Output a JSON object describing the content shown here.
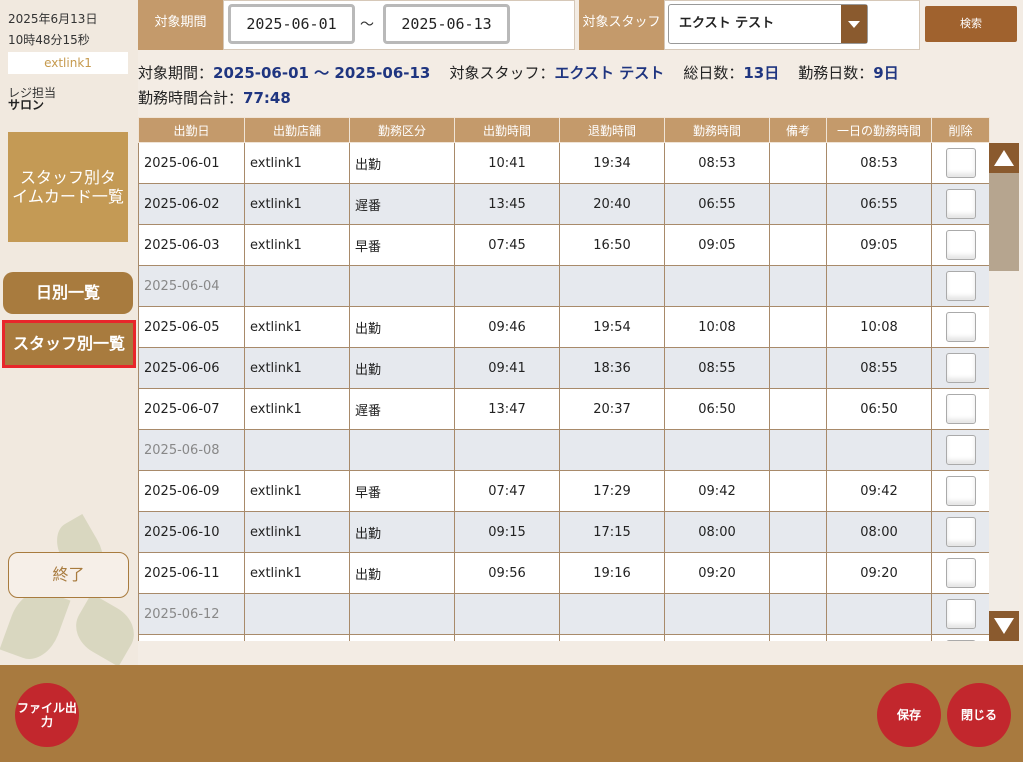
{
  "sidebar": {
    "date": "2025年6月13日",
    "time": "10時48分15秒",
    "store": "extlink1",
    "role": "レジ担当",
    "salon": "サロン",
    "timecard_button": "スタッフ別タイムカード一覧",
    "daily_button": "日別一覧",
    "staff_button": "スタッフ別一覧",
    "end_button": "終了"
  },
  "filter": {
    "period_label": "対象期間",
    "date_from": "2025-06-01",
    "tilde": "～",
    "date_to": "2025-06-13",
    "staff_label": "対象スタッフ",
    "staff_value": "エクスト テスト",
    "search_button": "検索"
  },
  "summary": {
    "period_key": "対象期間：",
    "period_value": "2025-06-01 ～ 2025-06-13",
    "staff_key": "対象スタッフ：",
    "staff_value": "エクスト テスト",
    "total_days_key": "総日数：",
    "total_days_value": "13日",
    "work_days_key": "勤務日数：",
    "work_days_value": "9日",
    "total_hours_key": "勤務時間合計：",
    "total_hours_value": "77:48"
  },
  "table": {
    "headers": [
      "出勤日",
      "出勤店舗",
      "勤務区分",
      "出勤時間",
      "退勤時間",
      "勤務時間",
      "備考",
      "一日の勤務時間",
      "削除"
    ],
    "rows": [
      [
        "2025-06-01",
        "extlink1",
        "出勤",
        "10:41",
        "19:34",
        "08:53",
        "",
        "08:53"
      ],
      [
        "2025-06-02",
        "extlink1",
        "遅番",
        "13:45",
        "20:40",
        "06:55",
        "",
        "06:55"
      ],
      [
        "2025-06-03",
        "extlink1",
        "早番",
        "07:45",
        "16:50",
        "09:05",
        "",
        "09:05"
      ],
      [
        "2025-06-04",
        "",
        "",
        "",
        "",
        "",
        "",
        ""
      ],
      [
        "2025-06-05",
        "extlink1",
        "出勤",
        "09:46",
        "19:54",
        "10:08",
        "",
        "10:08"
      ],
      [
        "2025-06-06",
        "extlink1",
        "出勤",
        "09:41",
        "18:36",
        "08:55",
        "",
        "08:55"
      ],
      [
        "2025-06-07",
        "extlink1",
        "遅番",
        "13:47",
        "20:37",
        "06:50",
        "",
        "06:50"
      ],
      [
        "2025-06-08",
        "",
        "",
        "",
        "",
        "",
        "",
        ""
      ],
      [
        "2025-06-09",
        "extlink1",
        "早番",
        "07:47",
        "17:29",
        "09:42",
        "",
        "09:42"
      ],
      [
        "2025-06-10",
        "extlink1",
        "出勤",
        "09:15",
        "17:15",
        "08:00",
        "",
        "08:00"
      ],
      [
        "2025-06-11",
        "extlink1",
        "出勤",
        "09:56",
        "19:16",
        "09:20",
        "",
        "09:20"
      ],
      [
        "2025-06-12",
        "",
        "",
        "",
        "",
        "",
        "",
        ""
      ],
      [
        "",
        "",
        "",
        "",
        "",
        "",
        "",
        ""
      ]
    ]
  },
  "footer": {
    "file_output": "ファイル出力",
    "save": "保存",
    "close": "閉じる"
  }
}
